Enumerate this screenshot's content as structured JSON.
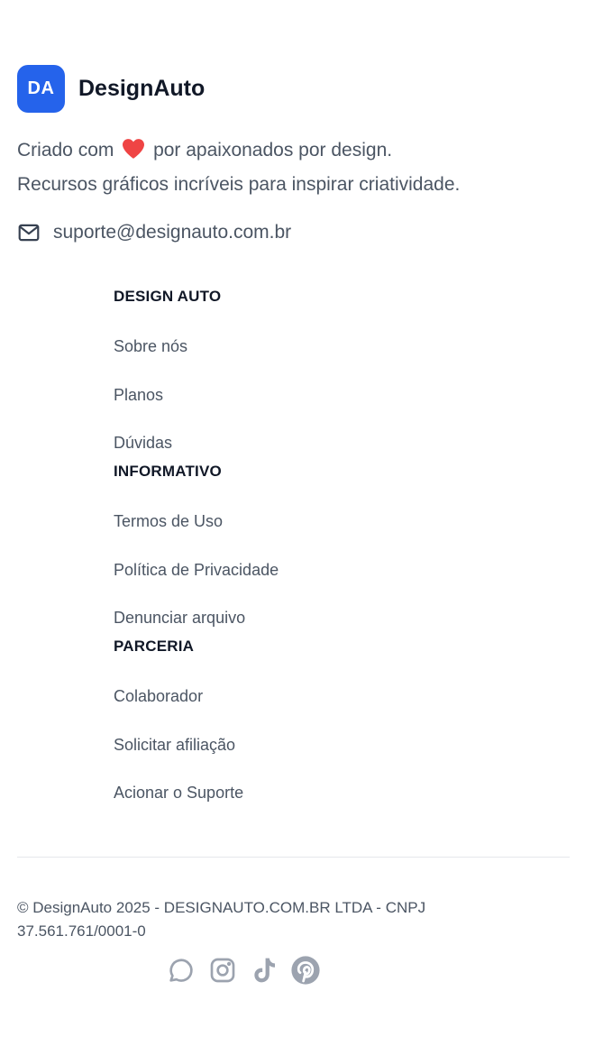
{
  "brand": {
    "logo_text": "DA",
    "name": "DesignAuto",
    "accent": "#2563eb"
  },
  "tagline": {
    "line1_before": "Criado com",
    "heart_icon": "heart-icon",
    "line1_after": "por apaixonados por design.",
    "line2": "Recursos gráficos incríveis para inspirar criatividade."
  },
  "contact": {
    "icon": "mail-icon",
    "email": "suporte@designauto.com.br"
  },
  "columns": [
    {
      "title": "DESIGN AUTO",
      "links": [
        "Sobre nós",
        "Planos",
        "Dúvidas"
      ]
    },
    {
      "title": "INFORMATIVO",
      "links": [
        "Termos de Uso",
        "Política de Privacidade",
        "Denunciar arquivo"
      ]
    },
    {
      "title": "PARCERIA",
      "links": [
        "Colaborador",
        "Solicitar afiliação",
        "Acionar o Suporte"
      ]
    }
  ],
  "copyright": "© DesignAuto 2025 - DESIGNAUTO.COM.BR LTDA - CNPJ 37.561.761/0001-0",
  "socials": [
    "whatsapp-icon",
    "instagram-icon",
    "tiktok-icon",
    "pinterest-icon"
  ]
}
